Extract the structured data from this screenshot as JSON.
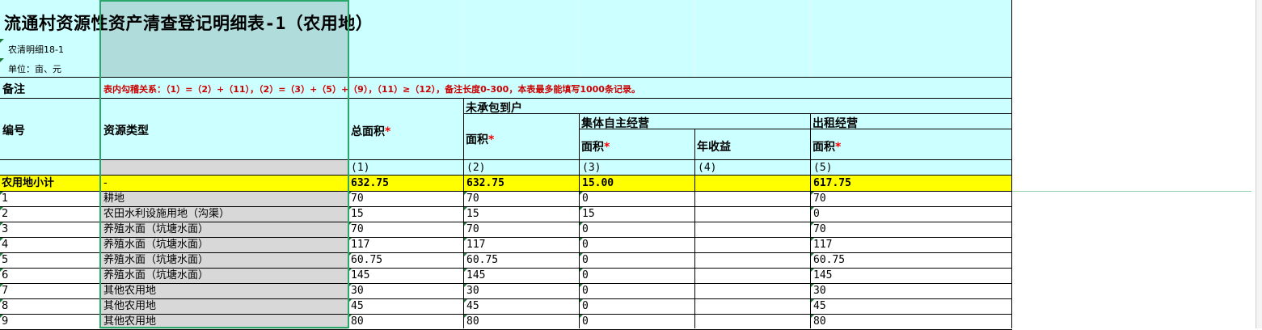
{
  "sheet": {
    "title": "流通村资源性资产清查登记明细表-1（农用地）",
    "code": "农清明细18-1",
    "unit": "单位：亩、元",
    "remark_label": "备注",
    "remark_text": "表内勾稽关系：（1）=（2）+（11），（2）=（3）+（5）+（9），（11）≥（12），备注长度0-300，本表最多能填写1000条记录。"
  },
  "headers": {
    "id": "编号",
    "type": "资源类型",
    "total_area": "总面积",
    "uncontracted": "未承包到户",
    "area": "面积",
    "collective": "集体自主经营",
    "collective_area": "面积",
    "annual_income": "年收益",
    "rental": "出租经营",
    "rental_area": "面积",
    "required_mark": "*",
    "col1": "(1)",
    "col2": "(2)",
    "col3": "(3)",
    "col4": "(4)",
    "col5": "(5)"
  },
  "subtotal": {
    "label": "农用地小计",
    "type": "-",
    "total": "632.75",
    "uncontracted": "632.75",
    "collective_area": "15.00",
    "annual_income": "",
    "rental_area": "617.75"
  },
  "rows": [
    {
      "id": "1",
      "type": "耕地",
      "total": "70",
      "uncontracted": "70",
      "collective_area": "0",
      "annual_income": "",
      "rental_area": "70"
    },
    {
      "id": "2",
      "type": "农田水利设施用地（沟渠）",
      "total": "15",
      "uncontracted": "15",
      "collective_area": "15",
      "annual_income": "",
      "rental_area": "0"
    },
    {
      "id": "3",
      "type": "养殖水面（坑塘水面）",
      "total": "70",
      "uncontracted": "70",
      "collective_area": "0",
      "annual_income": "",
      "rental_area": "70"
    },
    {
      "id": "4",
      "type": "养殖水面（坑塘水面）",
      "total": "117",
      "uncontracted": "117",
      "collective_area": "0",
      "annual_income": "",
      "rental_area": "117"
    },
    {
      "id": "5",
      "type": "养殖水面（坑塘水面）",
      "total": "60.75",
      "uncontracted": "60.75",
      "collective_area": "0",
      "annual_income": "",
      "rental_area": "60.75"
    },
    {
      "id": "6",
      "type": "养殖水面（坑塘水面）",
      "total": "145",
      "uncontracted": "145",
      "collective_area": "0",
      "annual_income": "",
      "rental_area": "145"
    },
    {
      "id": "7",
      "type": "其他农用地",
      "total": "30",
      "uncontracted": "30",
      "collective_area": "0",
      "annual_income": "",
      "rental_area": "30"
    },
    {
      "id": "8",
      "type": "其他农用地",
      "total": "45",
      "uncontracted": "45",
      "collective_area": "0",
      "annual_income": "",
      "rental_area": "45"
    },
    {
      "id": "9",
      "type": "其他农用地",
      "total": "80",
      "uncontracted": "80",
      "collective_area": "0",
      "annual_income": "",
      "rental_area": "80"
    }
  ],
  "colors": {
    "header_bg": "#ccffff",
    "subtotal_bg": "#ffff00",
    "selected_column_bg": "#d8d8d8",
    "remark_text": "#cc0000",
    "selection_border": "#2aa86a"
  }
}
